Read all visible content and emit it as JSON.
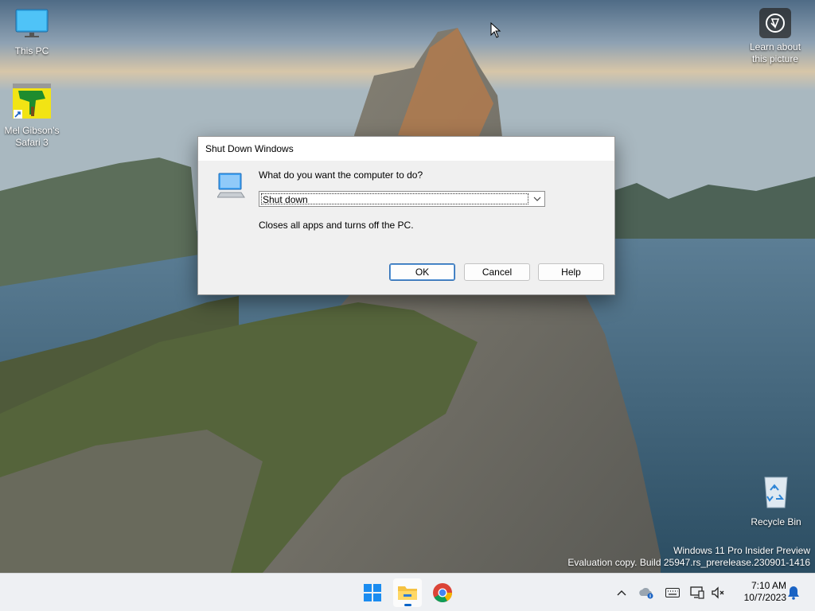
{
  "desktop": {
    "icons": [
      {
        "label": "This PC"
      },
      {
        "label": "Mel Gibson's Safari 3"
      },
      {
        "label": "Recycle Bin"
      }
    ],
    "spotlight_label": "Learn about this picture"
  },
  "dialog": {
    "title": "Shut Down Windows",
    "question": "What do you want the computer to do?",
    "selected_option": "Shut down",
    "description": "Closes all apps and turns off the PC.",
    "ok_label": "OK",
    "cancel_label": "Cancel",
    "help_label": "Help"
  },
  "watermark": {
    "line1": "Windows 11 Pro Insider Preview",
    "line2": "Evaluation copy. Build 25947.rs_prerelease.230901-1416"
  },
  "taskbar": {
    "apps": [
      "windows-start-icon",
      "file-explorer-icon",
      "chrome-icon"
    ],
    "tray_icons": [
      "chevron-up-icon",
      "onedrive-icon",
      "keyboard-icon",
      "display-icon",
      "volume-muted-icon",
      "notification-bell-icon"
    ],
    "time": "7:10 AM",
    "date": "10/7/2023"
  },
  "colors": {
    "accent": "#0a64c8",
    "dialog_bg": "#f0f0f0",
    "taskbar_bg": "#eef0f3"
  }
}
